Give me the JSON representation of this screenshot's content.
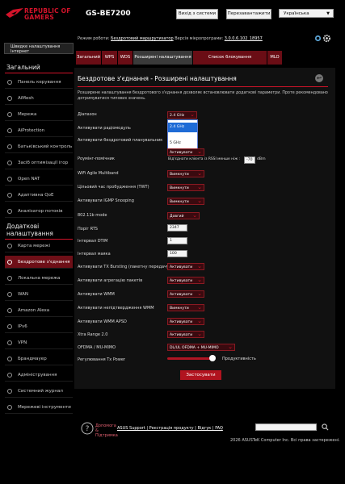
{
  "header": {
    "brand_line1": "REPUBLIC OF",
    "brand_line2": "GAMERS",
    "model": "GS-BE7200",
    "logout": "Вихід з системи",
    "reboot": "Перезавантажити",
    "language": "Українська"
  },
  "info": {
    "mode_label": "Режим роботи:",
    "mode_value": "Бездротовий маршрутизатор",
    "fw_label": "Версія мікропрограми:",
    "fw_value": "3.0.0.6.102_18957"
  },
  "sidebar": {
    "quick": "Швидке налаштування Інтернет",
    "general_title": "Загальний",
    "general": [
      {
        "label": "Панель керування"
      },
      {
        "label": "AiMesh"
      },
      {
        "label": "Мережа"
      },
      {
        "label": "AiProtection"
      },
      {
        "label": "Батьківський контроль"
      },
      {
        "label": "Засіб оптимізації ігор"
      },
      {
        "label": "Open NAT"
      },
      {
        "label": "Адаптивна QoE"
      },
      {
        "label": "Аналізатор потоків"
      }
    ],
    "advanced_title": "Додаткові налаштування",
    "advanced": [
      {
        "label": "Карта мережі"
      },
      {
        "label": "Бездротове з'єднання"
      },
      {
        "label": "Локальна мережа"
      },
      {
        "label": "WAN"
      },
      {
        "label": "Amazon Alexa"
      },
      {
        "label": "IPv6"
      },
      {
        "label": "VPN"
      },
      {
        "label": "Брандмауер"
      },
      {
        "label": "Адміністрування"
      },
      {
        "label": "Системний журнал"
      },
      {
        "label": "Мережеві інструменти"
      }
    ]
  },
  "tabs": [
    "Загальний",
    "WPS",
    "WDS",
    "Розширені налаштування",
    "Список блокування переміщення",
    "MLO"
  ],
  "panel": {
    "title": "Бездротове з'єднання - Розширені налаштування",
    "description": "Розширене налаштування бездротового з'єднання дозволяє встановлювати додаткові параметри. Проте рекомендовано дотримуватися типових значень.",
    "rows": [
      {
        "label": "Діапазон",
        "type": "select",
        "value": "2.4 GHz"
      },
      {
        "label": "Активувати радіомодуль",
        "type": "none",
        "value": ""
      },
      {
        "label": "Активувати бездротовий планувальник",
        "type": "none",
        "value": ""
      },
      {
        "label": "",
        "type": "select",
        "value": "Активувати"
      },
      {
        "label": "Роумінг-помічник",
        "type": "roam",
        "value": "-70"
      },
      {
        "label": "WiFi Agile Multiband",
        "type": "select",
        "value": "Вимкнути"
      },
      {
        "label": "Цільовий час пробудження (TWT)",
        "type": "select",
        "value": "Вимкнути"
      },
      {
        "label": "Активувати IGMP Snooping",
        "type": "select",
        "value": "Вимкнути"
      },
      {
        "label": "802.11b mode",
        "type": "select",
        "value": "Довгий"
      },
      {
        "label": "Поріг RTS",
        "type": "input",
        "value": "2347"
      },
      {
        "label": "Інтервал DTIM",
        "type": "input",
        "value": "1"
      },
      {
        "label": "Інтервал маяка",
        "type": "input",
        "value": "100"
      },
      {
        "label": "Активувати TX Bursting (пакетну передачу)",
        "type": "select",
        "value": "Активувати"
      },
      {
        "label": "Активувати агрегацію пакетів",
        "type": "select",
        "value": "Активувати"
      },
      {
        "label": "Активувати WMM",
        "type": "select",
        "value": "Активувати"
      },
      {
        "label": "Активувати непідтвердження WMM",
        "type": "select",
        "value": "Вимкнути"
      },
      {
        "label": "Активувати WMM APSD",
        "type": "select",
        "value": "Активувати"
      },
      {
        "label": "Xtra Range 2.0",
        "type": "select",
        "value": "Активувати"
      },
      {
        "label": "OFDMA / MU-MIMO",
        "type": "select",
        "value": "DL/UL OFDMA + MU-MIMO"
      },
      {
        "label": "Регулювання Tx Power",
        "type": "slider",
        "value": "Продуктивність"
      }
    ],
    "roam_text": "Від'єднати клієнта із RSSI менше ніж :",
    "roam_unit": "dBm",
    "dropdown_options": [
      "2.4 GHz",
      "5 GHz"
    ],
    "apply": "Застосувати",
    "tx_power_level": 1.0
  },
  "footer": {
    "help": "Допомога & Підтримка",
    "links": "ASUS Support | Реєстрація продукту | Відгук | FAQ",
    "copyright": "2026 ASUSTeK Computer Inc. Всі права застережені."
  },
  "colors": {
    "accent": "#d2132a",
    "tab": "#6a0d15",
    "background": "#000000"
  }
}
